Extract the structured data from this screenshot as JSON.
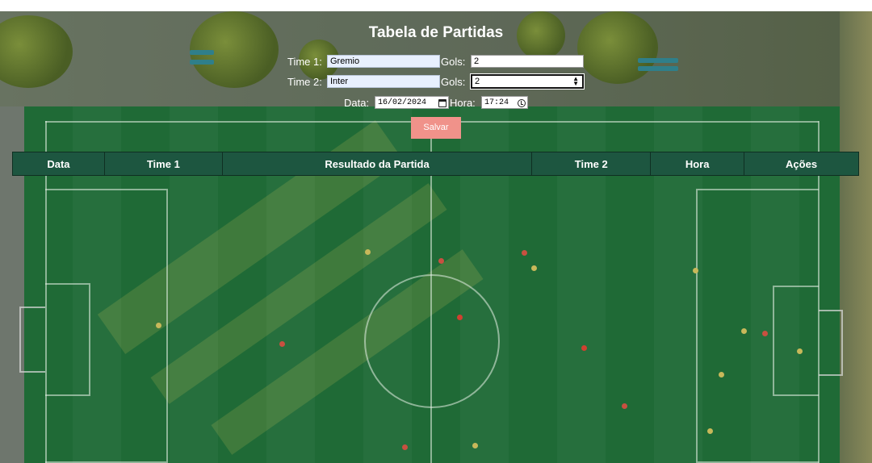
{
  "page": {
    "title": "Tabela de Partidas"
  },
  "form": {
    "time1_label": "Time 1:",
    "time1_value": "Gremio",
    "gols1_label": "Gols:",
    "gols1_value": "2",
    "time2_label": "Time 2:",
    "time2_value": "Inter",
    "gols2_label": "Gols:",
    "gols2_value": "2",
    "data_label": "Data:",
    "data_value": "16/02/2024",
    "hora_label": "Hora:",
    "hora_value": "17:24",
    "save_label": "Salvar"
  },
  "table": {
    "columns": [
      "Data",
      "Time 1",
      "Resultado da Partida",
      "Time 2",
      "Hora",
      "Ações"
    ]
  },
  "colors": {
    "header_bg": "#1d5640",
    "save_button": "#f0928a",
    "field": "#1f6a36"
  }
}
